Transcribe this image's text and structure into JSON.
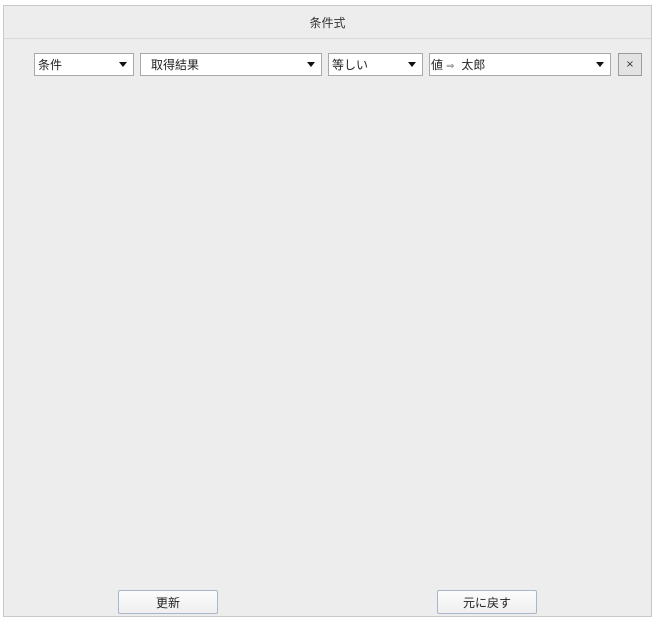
{
  "dialog": {
    "title": "条件式"
  },
  "condition": {
    "field": "条件",
    "source": "取得結果",
    "operator": "等しい",
    "value_prefix": "値",
    "value_arrow": "⇒",
    "value": "太郎",
    "remove_label": "×"
  },
  "footer": {
    "update_label": "更新",
    "revert_label": "元に戻す"
  },
  "icons": {
    "dropdown": "chevron-down-icon",
    "remove": "close-icon"
  }
}
